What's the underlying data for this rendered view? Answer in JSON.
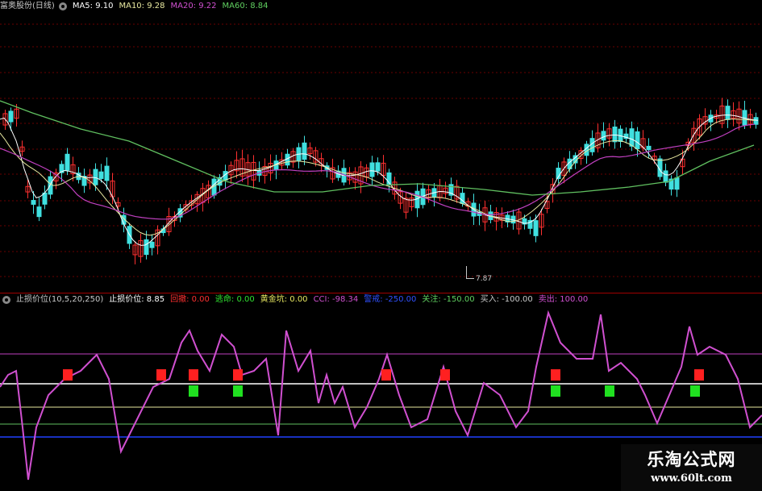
{
  "price_header": {
    "title": "富奥股份(日线)",
    "ma5": "MA5: 9.10",
    "ma10": "MA10: 9.28",
    "ma20": "MA20: 9.22",
    "ma60": "MA60: 8.84"
  },
  "indicator_header": {
    "name": "止损价位(10,5,20,250)",
    "stop_price": "止损价位: 8.85",
    "pullback": "回撤: 0.00",
    "escape": "逃命: 0.00",
    "golden_pit": "黄金坑: 0.00",
    "cci": "CCI: -98.34",
    "alert": "警戒: -250.00",
    "focus": "关注: -150.00",
    "buy": "买入: -100.00",
    "sell": "卖出: 100.00"
  },
  "low_marker": "7.87",
  "watermark": {
    "title": "乐淘公式网",
    "url": "www.60lt.com"
  },
  "colors": {
    "ma5": "#ffffff",
    "ma10": "#e8e8a0",
    "ma20": "#c040c0",
    "ma60": "#60c060",
    "candle_up": "#ff3030",
    "candle_down": "#40e0e0",
    "cci": "#d050d0",
    "sell_line": "#c040c0",
    "buy_line": "#ffffff",
    "focus_line": "#e8e8a0",
    "alert_line": "#60c060",
    "bottom_line": "#2040ff",
    "red_signal": "#ff2020",
    "green_signal": "#20e020"
  }
}
